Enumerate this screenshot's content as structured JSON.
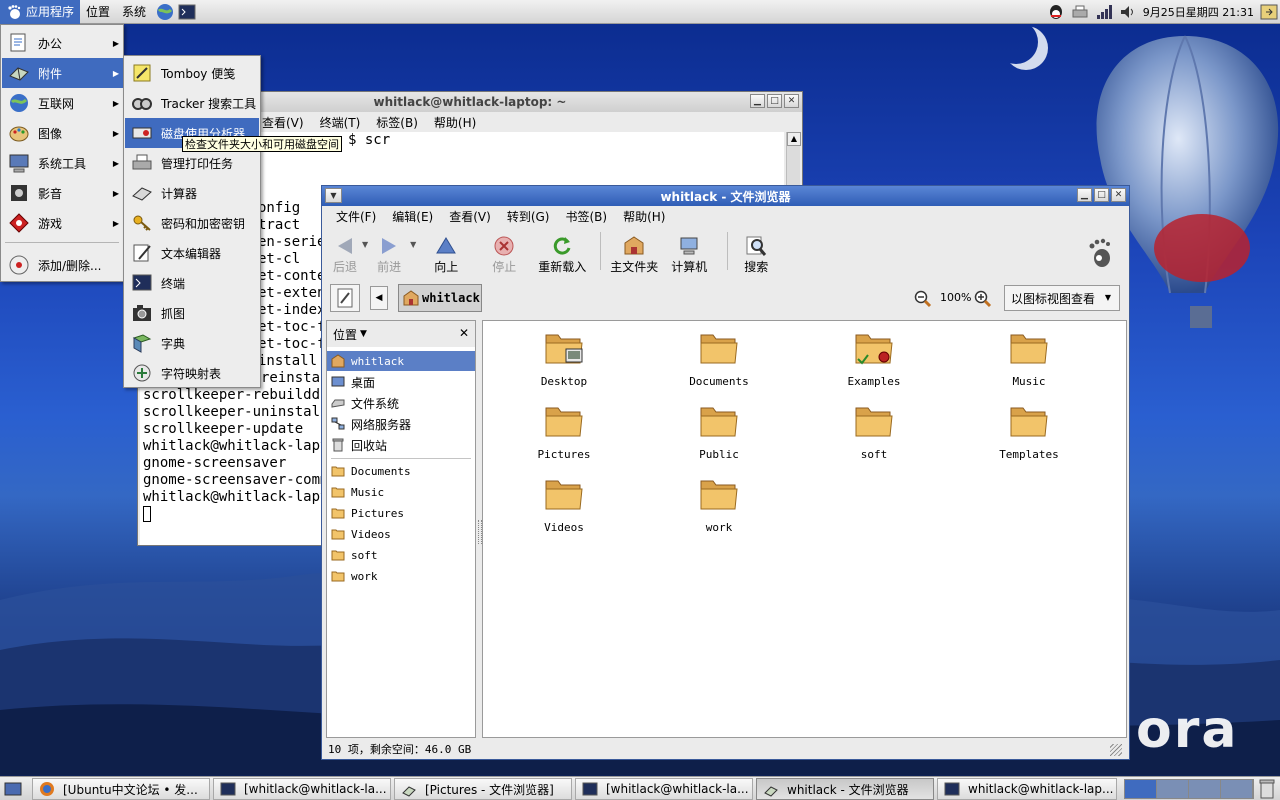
{
  "top_panel": {
    "menus": [
      "应用程序",
      "位置",
      "系统"
    ],
    "clock": "9月25日星期四 21:31"
  },
  "app_menu": {
    "items": [
      {
        "label": "办公",
        "icon": "office-icon"
      },
      {
        "label": "附件",
        "icon": "accessories-icon"
      },
      {
        "label": "互联网",
        "icon": "internet-icon"
      },
      {
        "label": "图像",
        "icon": "graphics-icon"
      },
      {
        "label": "系统工具",
        "icon": "system-tools-icon"
      },
      {
        "label": "影音",
        "icon": "multimedia-icon"
      },
      {
        "label": "游戏",
        "icon": "games-icon"
      }
    ],
    "add_remove": "添加/删除..."
  },
  "accessories_menu": {
    "items": [
      {
        "label": "Tomboy 便笺",
        "icon": "tomboy-icon"
      },
      {
        "label": "Tracker 搜索工具",
        "icon": "tracker-icon"
      },
      {
        "label": "磁盘使用分析器",
        "icon": "disk-analyzer-icon"
      },
      {
        "label": "管理打印任务",
        "icon": "printer-icon"
      },
      {
        "label": "计算器",
        "icon": "calculator-icon"
      },
      {
        "label": "密码和加密密钥",
        "icon": "keys-icon"
      },
      {
        "label": "文本编辑器",
        "icon": "text-editor-icon"
      },
      {
        "label": "终端",
        "icon": "terminal-icon"
      },
      {
        "label": "抓图",
        "icon": "screenshot-icon"
      },
      {
        "label": "字典",
        "icon": "dictionary-icon"
      },
      {
        "label": "字符映射表",
        "icon": "charmap-icon"
      }
    ],
    "tooltip": "检查文件夹大小和可用磁盘空间"
  },
  "terminal": {
    "title": "whitlack@whitlack-laptop: ~",
    "menus": [
      "查看(V)",
      "终端(T)",
      "标签(B)",
      "帮助(H)"
    ],
    "lines": [
      "$ scr",
      "",
      "",
      "",
      "onfig",
      "tract",
      "en-series",
      "et-cl",
      "et-conter",
      "et-extend",
      "et-index",
      "et-toc-f",
      "et-toc-f",
      "install",
      "scrollkeeper-preinstal",
      "scrollkeeper-rebuilddb",
      "scrollkeeper-uninstall",
      "scrollkeeper-update",
      "whitlack@whitlack-lapto",
      "gnome-screensaver",
      "gnome-screensaver-comma",
      "whitlack@whitlack-lapto"
    ]
  },
  "browser": {
    "title": "whitlack - 文件浏览器",
    "menus": [
      "文件(F)",
      "编辑(E)",
      "查看(V)",
      "转到(G)",
      "书签(B)",
      "帮助(H)"
    ],
    "toolbar": {
      "back": "后退",
      "forward": "前进",
      "up": "向上",
      "stop": "停止",
      "reload": "重新载入",
      "home": "主文件夹",
      "computer": "计算机",
      "search": "搜索"
    },
    "location": "whitlack",
    "zoom": "100%",
    "view_mode": "以图标视图查看",
    "sidebar": {
      "header": "位置",
      "places": [
        "whitlack",
        "桌面",
        "文件系统",
        "网络服务器",
        "回收站"
      ],
      "bookmarks": [
        "Documents",
        "Music",
        "Pictures",
        "Videos",
        "soft",
        "work"
      ]
    },
    "files": [
      "Desktop",
      "Documents",
      "Examples",
      "Music",
      "Pictures",
      "Public",
      "soft",
      "Templates",
      "Videos",
      "work"
    ],
    "status": "10 项，剩余空间：46.0 GB"
  },
  "taskbar": {
    "tasks": [
      "[Ubuntu中文论坛 • 发...",
      "[whitlack@whitlack-la...",
      "[Pictures - 文件浏览器]",
      "[whitlack@whitlack-la...",
      "whitlack - 文件浏览器",
      "whitlack@whitlack-lap..."
    ]
  },
  "brand_text": "ora",
  "colors": {
    "selection": "#3f6bbf",
    "browser_title": "#2f5db5",
    "folder": "#f2c46a"
  }
}
